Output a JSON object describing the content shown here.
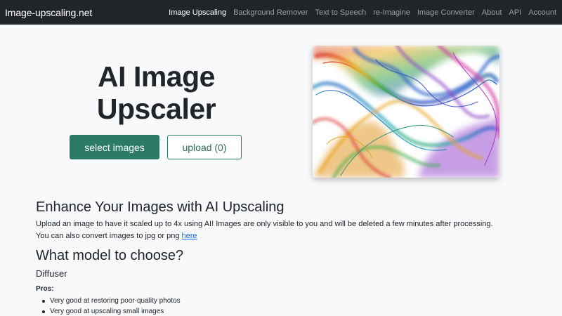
{
  "navbar": {
    "brand": "Image-upscaling.net",
    "links": [
      {
        "label": "Image Upscaling",
        "active": true
      },
      {
        "label": "Background Remover",
        "active": false
      },
      {
        "label": "Text to Speech",
        "active": false
      },
      {
        "label": "re-Imagine",
        "active": false
      },
      {
        "label": "Image Converter",
        "active": false
      },
      {
        "label": "About",
        "active": false
      },
      {
        "label": "API",
        "active": false
      },
      {
        "label": "Account",
        "active": false
      }
    ]
  },
  "hero": {
    "title_line1": "AI Image",
    "title_line2": "Upscaler",
    "select_button": "select images",
    "upload_button": "upload (0)",
    "image_icon": "colorful-smoke-image"
  },
  "content": {
    "heading": "Enhance Your Images with AI Upscaling",
    "description_line1": "Upload an image to have it scaled up to 4x using AI! Images are only visible to you and will be deleted a few minutes after processing.",
    "description_line2_prefix": "You can also convert images to jpg or png ",
    "description_link": "here",
    "model_heading": "What model to choose?",
    "model_name": "Diffuser",
    "pros_label": "Pros:",
    "pros": [
      "Very good at restoring poor-quality photos",
      "Very good at upscaling small images"
    ]
  },
  "colors": {
    "navbar_bg": "#212529",
    "primary_green": "#2b7a66",
    "link_blue": "#0d6efd",
    "page_bg": "#f8f9fa"
  }
}
